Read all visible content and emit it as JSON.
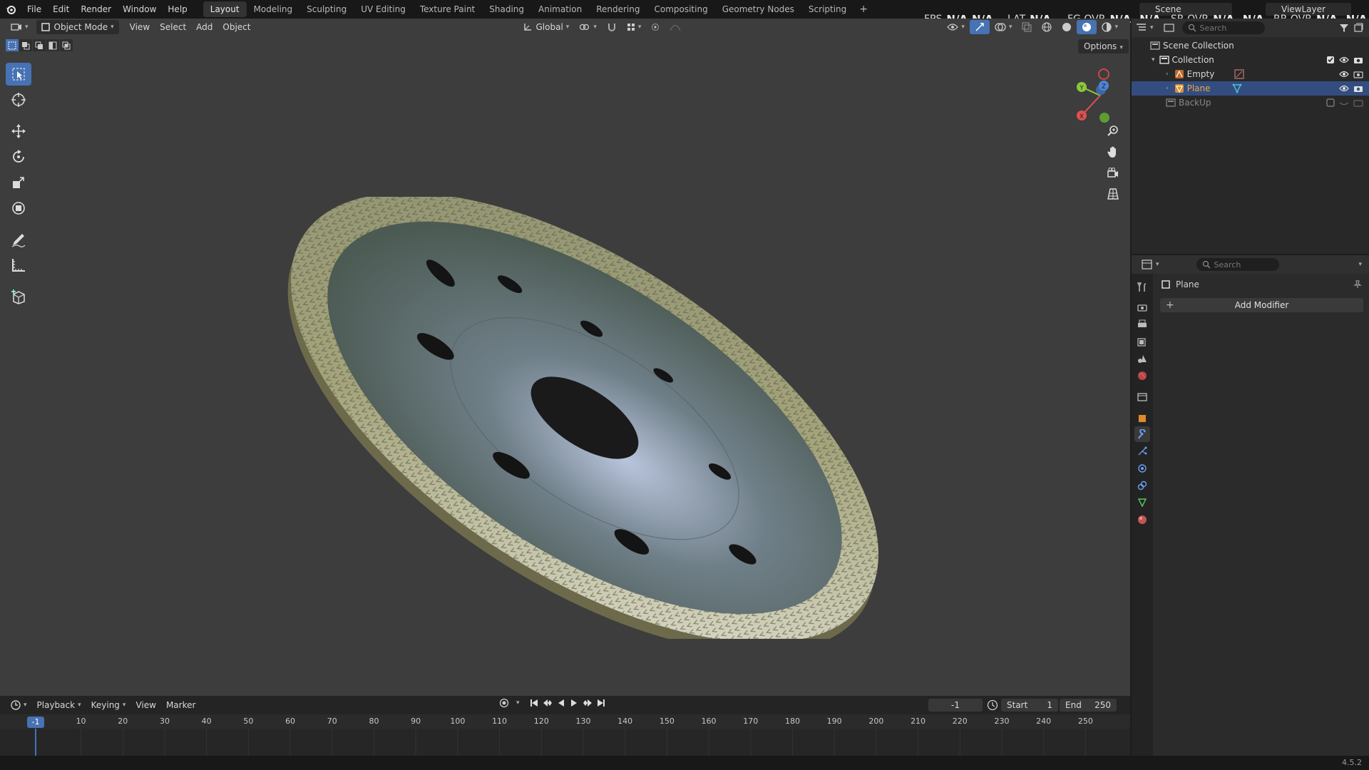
{
  "topbar": {
    "menus": [
      "File",
      "Edit",
      "Render",
      "Window",
      "Help"
    ],
    "workspaces": [
      "Layout",
      "Modeling",
      "Sculpting",
      "UV Editing",
      "Texture Paint",
      "Shading",
      "Animation",
      "Rendering",
      "Compositing",
      "Geometry Nodes",
      "Scripting"
    ],
    "active_workspace": "Layout",
    "scene_name": "Scene",
    "view_layer": "ViewLayer"
  },
  "stats": {
    "fps_label": "FPS",
    "fps_value": "N/A",
    "fps_value2": "N/A",
    "lat_label": "LAT",
    "lat_value": "N/A",
    "fg_label": "FG OVR",
    "fg_value": "N/A,",
    "fg_value2": "N/A",
    "sr_label": "SR OVR",
    "sr_value": "N/A,",
    "sr_value2": "N/A",
    "rr_label": "RR OVR",
    "rr_value": "N/A,",
    "rr_value2": "N/A"
  },
  "viewport": {
    "mode": "Object Mode",
    "menus": [
      "View",
      "Select",
      "Add",
      "Object"
    ],
    "transform_orientation": "Global",
    "options_label": "Options"
  },
  "outliner": {
    "search_placeholder": "Search",
    "root": "Scene Collection",
    "collection": "Collection",
    "items": [
      "Empty",
      "Plane"
    ],
    "selected": "Plane",
    "extra_collection": "BackUp"
  },
  "properties": {
    "search_placeholder": "Search",
    "object_name": "Plane",
    "add_modifier": "Add Modifier"
  },
  "timeline": {
    "menus": [
      "Playback",
      "Keying",
      "View",
      "Marker"
    ],
    "current_frame": "-1",
    "current_frame_field": "-1",
    "start_label": "Start",
    "start_value": "1",
    "end_label": "End",
    "end_value": "250",
    "ruler_ticks": [
      "10",
      "20",
      "30",
      "40",
      "50",
      "60",
      "70",
      "80",
      "90",
      "100",
      "110",
      "120",
      "130",
      "140",
      "150",
      "160",
      "170",
      "180",
      "190",
      "200",
      "210",
      "220",
      "230",
      "240",
      "250"
    ]
  },
  "status": {
    "version": "4.5.2"
  },
  "colors": {
    "accent": "#4772b3",
    "viewport_bg": "#3d3d3d",
    "selected_row": "#334d80"
  }
}
